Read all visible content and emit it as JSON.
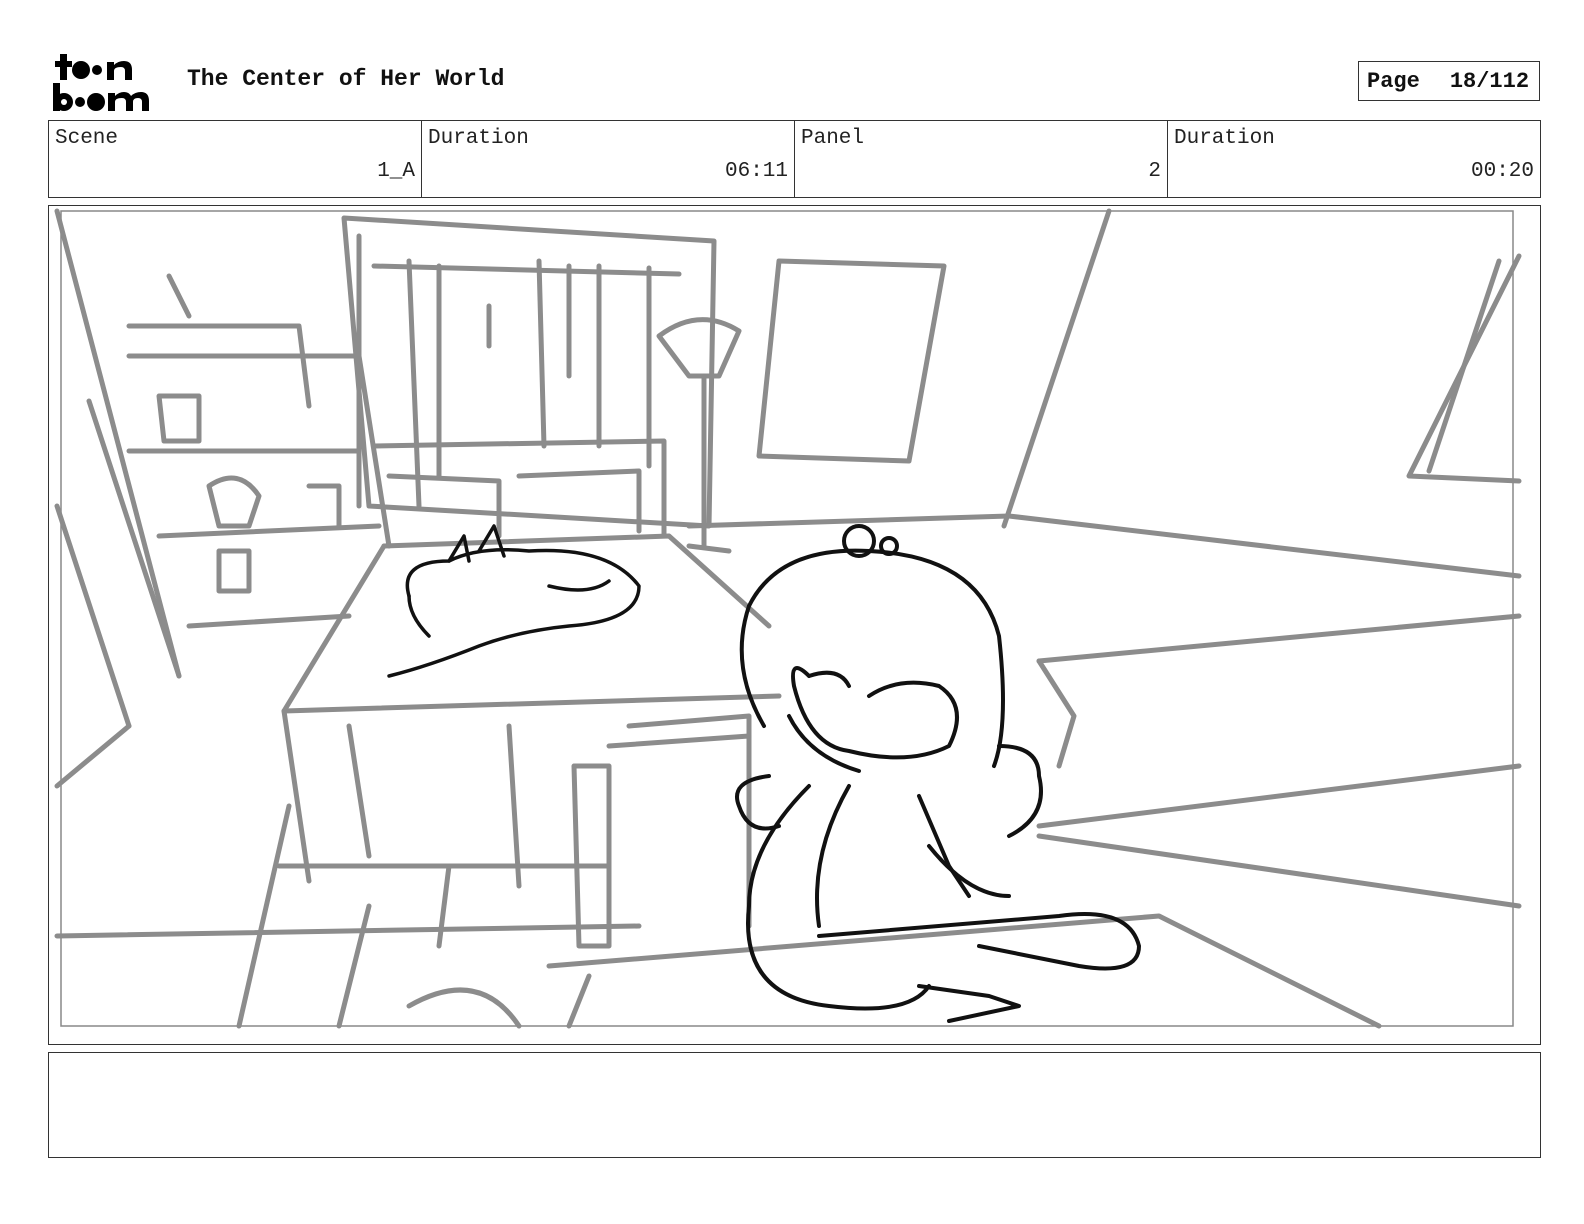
{
  "header": {
    "logo_alt": "toon boom",
    "title": "The Center of Her World",
    "page_label": "Page",
    "page_value": "18/112"
  },
  "info": {
    "scene_label": "Scene",
    "scene_value": "1_A",
    "duration_label": "Duration",
    "duration_value": "06:11",
    "panel_label": "Panel",
    "panel_value": "2",
    "panel_duration_label": "Duration",
    "panel_duration_value": "00:20"
  },
  "panel": {
    "image": "rough storyboard sketch of a bedroom: bookshelf, window with blinds, floor lamp, wall poster, bed with a sleeping cat, girl with hair bun sitting at a desk"
  },
  "notes": {
    "text": ""
  }
}
